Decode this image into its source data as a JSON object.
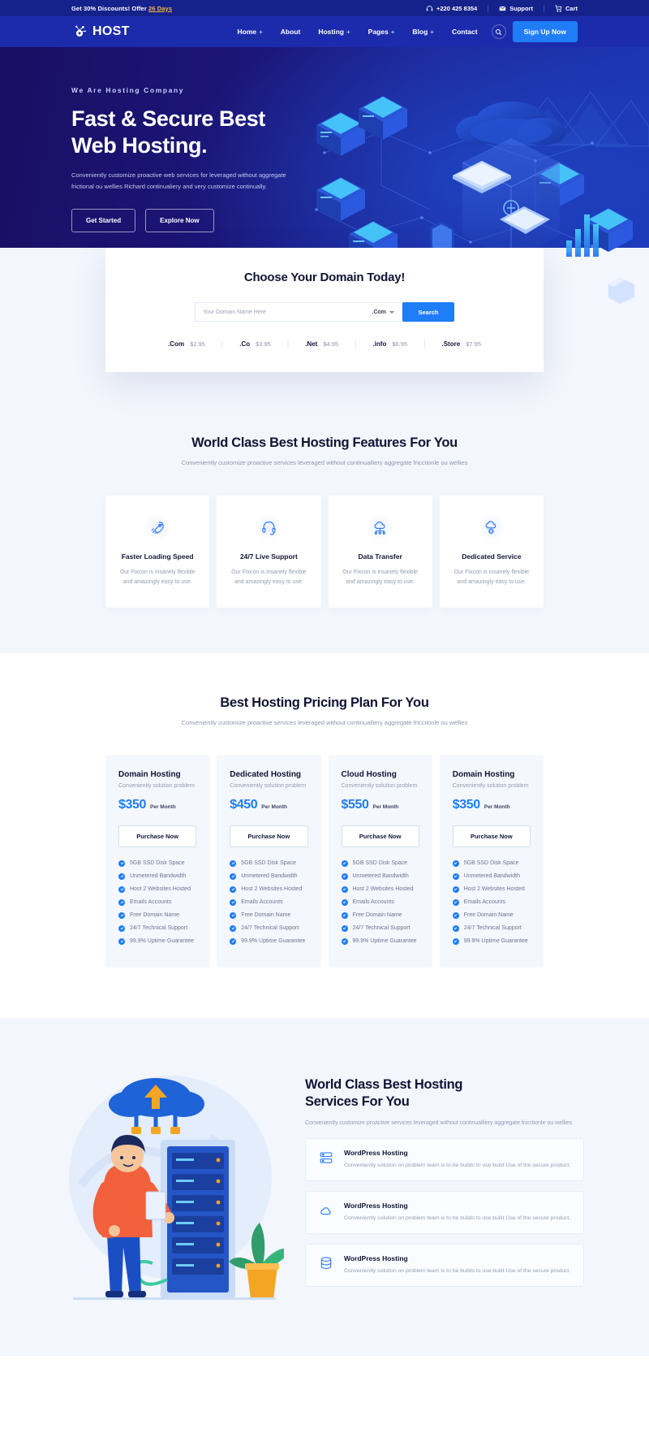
{
  "topbar": {
    "offer_prefix": "Get 30% Discounts! Offer",
    "offer_days": "26 Days",
    "phone": "+220 425 8354",
    "support": "Support",
    "cart": "Cart"
  },
  "nav": {
    "brand": "HOST",
    "links": [
      {
        "label": "Home",
        "plus": "+"
      },
      {
        "label": "About",
        "plus": ""
      },
      {
        "label": "Hosting",
        "plus": "+"
      },
      {
        "label": "Pages",
        "plus": "+"
      },
      {
        "label": "Blog",
        "plus": "+"
      },
      {
        "label": "Contact",
        "plus": ""
      }
    ],
    "signup": "Sign Up Now"
  },
  "hero": {
    "eyebrow": "We Are Hosting Company",
    "title_line1": "Fast & Secure Best",
    "title_line2": "Web Hosting.",
    "paragraph": "Conveniently customize proactive web services for leveraged without aggregate frictional ou wellies Richard continualiery and very customize continually.",
    "btn_primary": "Get Started",
    "btn_secondary": "Explore Now",
    "slide_count": 3,
    "active_slide": 3
  },
  "domain": {
    "title": "Choose Your Domain Today!",
    "placeholder": "Your Domain Name Here",
    "value": "",
    "tld_selected": ".Com",
    "search_label": "Search",
    "tlds": [
      {
        "name": ".Com",
        "price": "$2.95"
      },
      {
        "name": ".Co",
        "price": "$3.95"
      },
      {
        "name": ".Net",
        "price": "$4.95"
      },
      {
        "name": ".info",
        "price": "$6.95"
      },
      {
        "name": ".Store",
        "price": "$7.95"
      }
    ]
  },
  "features": {
    "title": "World Class Best Hosting Features For You",
    "subtitle": "Conveniently customize proactive services leveraged without continualliery aggregate fricctionle ou wellies",
    "cards": [
      {
        "icon": "rocket-icon",
        "title": "Faster Loading Speed",
        "desc": "Our Fixcon is insanely flexible and amazingly easy to use."
      },
      {
        "icon": "headset-icon",
        "title": "24/7 Live Support",
        "desc": "Our Fixcon is insanely flexible and amazingly easy to use."
      },
      {
        "icon": "cloud-network-icon",
        "title": "Data Transfer",
        "desc": "Our Fixcon is insanely flexible and amazingly easy to use."
      },
      {
        "icon": "cloud-gear-icon",
        "title": "Dedicated Service",
        "desc": "Our Fixcon is insanely flexible and amazingly easy to use."
      }
    ]
  },
  "pricing": {
    "title": "Best Hosting Pricing Plan For You",
    "subtitle": "Conveniently customize proactive services leveraged without continualliery aggregate fricctionle ou wellies",
    "button_label": "Purchase Now",
    "features_list": [
      "5GB SSD Disk Space",
      "Unmetered Bandwidth",
      "Host 2 Websites Hosted",
      "Emails Accounts",
      "Free Domain Name",
      "24/7 Technical Support",
      "99.9% Uptime Guarantee"
    ],
    "plans": [
      {
        "name": "Domain Hosting",
        "sub": "Conveniently solution problem",
        "price": "$350",
        "per": "Per Month"
      },
      {
        "name": "Dedicated Hosting",
        "sub": "Conveniently solution problem",
        "price": "$450",
        "per": "Per Month"
      },
      {
        "name": "Cloud Hosting",
        "sub": "Conveniently solution problem",
        "price": "$550",
        "per": "Per Month"
      },
      {
        "name": "Domain Hosting",
        "sub": "Conveniently solution problem",
        "price": "$350",
        "per": "Per Month"
      }
    ]
  },
  "services": {
    "title_line1": "World Class Best Hosting",
    "title_line2": "Services For You",
    "subtitle": "Conveniently customize proactive services leveraged without continualliery aggregate fricctionle ou wellies",
    "cards": [
      {
        "icon": "server-icon",
        "title": "WordPress Hosting",
        "desc": "Conveniently solution on problem team is to be builds to use build Use of the secure product."
      },
      {
        "icon": "cloud-icon",
        "title": "WordPress Hosting",
        "desc": "Conveniently solution on problem team is to be builds to use build Use of the secure product."
      },
      {
        "icon": "database-icon",
        "title": "WordPress Hosting",
        "desc": "Conveniently solution on problem team is to be builds to use build Use of the secure product."
      }
    ]
  },
  "colors": {
    "brand_blue": "#1f7df7",
    "navy": "#1b2bab",
    "topbar": "#16228c",
    "accent_gold": "#f5b642"
  }
}
